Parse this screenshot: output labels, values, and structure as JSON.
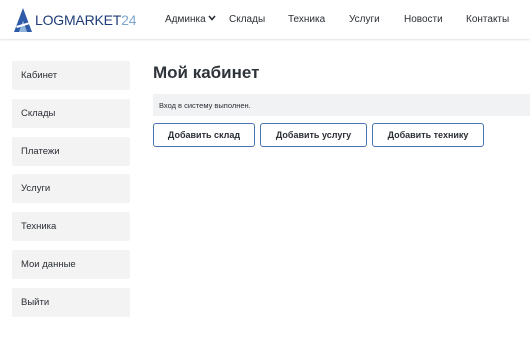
{
  "header": {
    "logo": {
      "text_main": "LOGMARKET",
      "text_num": "24",
      "mark_color": "#2f5aa8",
      "text_color": "#1f3e78",
      "num_color": "#7ea7cf"
    },
    "nav": {
      "admin": {
        "label": "Админка",
        "icon": "chevron-down-icon"
      },
      "warehouses": "Склады",
      "equipment": "Техника",
      "services": "Услуги",
      "news": "Новости",
      "contacts": "Контакты"
    }
  },
  "sidebar": {
    "items": [
      "Кабинет",
      "Склады",
      "Платежи",
      "Услуги",
      "Техника",
      "Мои данные",
      "Выйти"
    ]
  },
  "main": {
    "title": "Мой кабинет",
    "alert": "Вход в систему выполнен.",
    "buttons": {
      "add_warehouse": "Добавить склад",
      "add_service": "Добавить услугу",
      "add_equipment": "Добавить технику"
    },
    "button_border_color": "#4a74b4"
  }
}
